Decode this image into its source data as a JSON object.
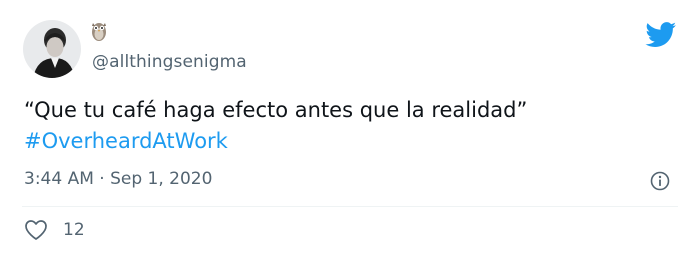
{
  "tweet": {
    "handle": "@allthingsenigma",
    "text_line1": "“Que tu café haga efecto antes que la realidad”",
    "hashtag": "#OverheardAtWork",
    "time": "3:44 AM",
    "separator": "·",
    "date": "Sep 1, 2020",
    "likes": "12"
  },
  "icons": {
    "brand": "twitter-bird-icon",
    "badge": "owl-emoji-icon",
    "info": "info-icon",
    "like": "heart-icon"
  },
  "colors": {
    "brand_blue": "#1d9bf0",
    "secondary_text": "#536471",
    "primary_text": "#0f1419",
    "divider": "#eff3f4"
  }
}
